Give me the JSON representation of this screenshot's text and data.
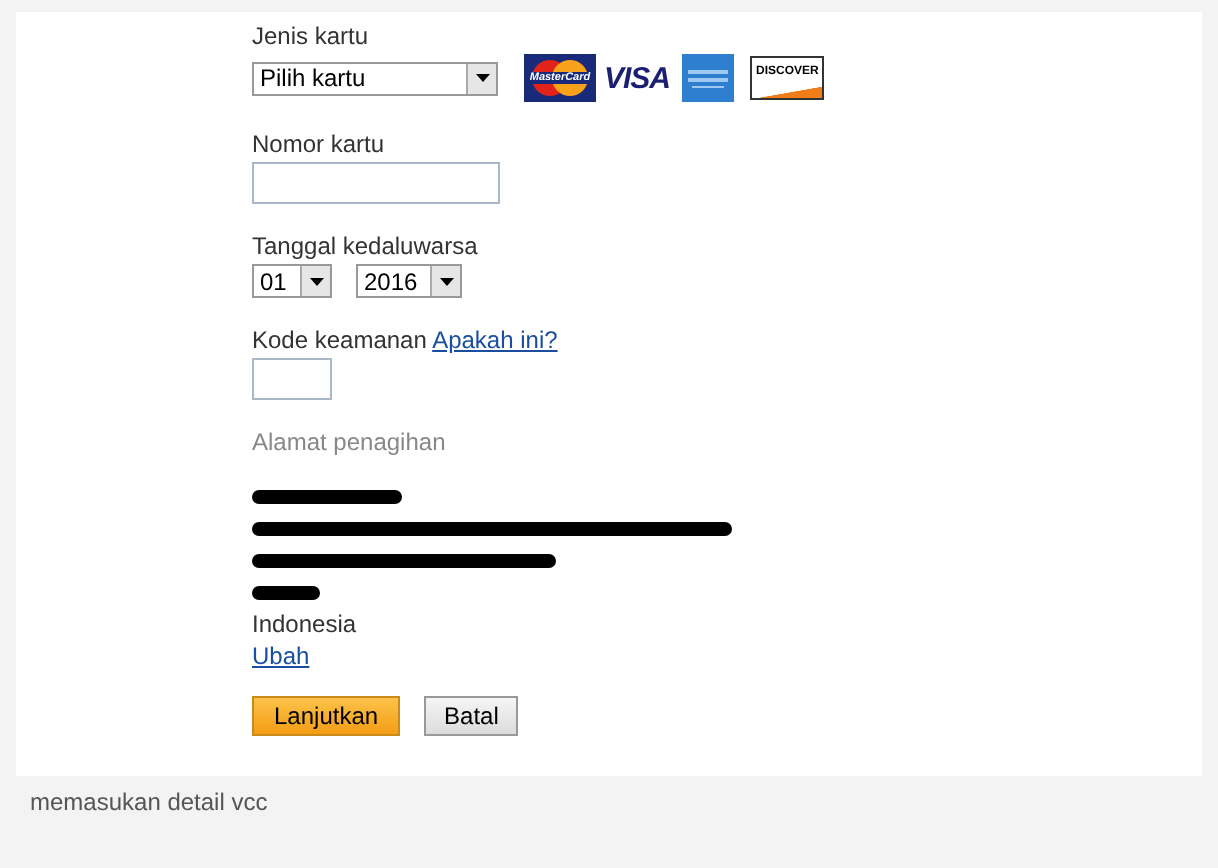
{
  "form": {
    "card_type": {
      "label": "Jenis kartu",
      "value": "Pilih kartu"
    },
    "card_logos": [
      {
        "kind": "mastercard",
        "text": "MasterCard"
      },
      {
        "kind": "visa",
        "text": "VISA"
      },
      {
        "kind": "amex"
      },
      {
        "kind": "discover",
        "text": "DISCOVER"
      }
    ],
    "card_number": {
      "label": "Nomor kartu"
    },
    "expiry": {
      "label": "Tanggal kedaluwarsa",
      "month": "01",
      "year": "2016"
    },
    "security_code": {
      "label": "Kode keamanan",
      "link": "Apakah ini?"
    },
    "billing_address": {
      "label": "Alamat penagihan",
      "lines": [
        {
          "kind": "redacted"
        },
        {
          "kind": "redacted"
        },
        {
          "kind": "redacted"
        },
        {
          "kind": "redacted"
        },
        {
          "kind": "text",
          "text": "Indonesia"
        }
      ],
      "link": "Ubah"
    },
    "buttons": [
      {
        "kind": "primary",
        "label": "Lanjutkan"
      },
      {
        "kind": "secondary",
        "label": "Batal"
      }
    ]
  },
  "caption": "memasukan detail vcc"
}
